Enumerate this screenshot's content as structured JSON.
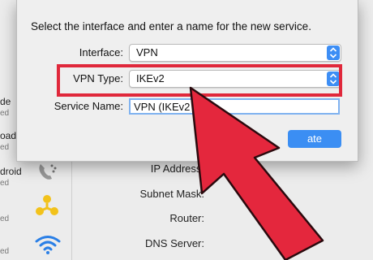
{
  "sidebar": {
    "items": [
      {
        "label": "de",
        "sub": "ed"
      },
      {
        "label": "oad",
        "sub": "ed"
      },
      {
        "label": "droid",
        "sub": "ed"
      },
      {
        "label": "",
        "sub": "ed"
      },
      {
        "label": "",
        "sub": "ed"
      }
    ]
  },
  "details": {
    "ip_label": "IP Address:",
    "subnet_label": "Subnet Mask:",
    "router_label": "Router:",
    "dns_label": "DNS Server:"
  },
  "dialog": {
    "title": "Select the interface and enter a name for the new service.",
    "interface_label": "Interface:",
    "interface_value": "VPN",
    "vpn_type_label": "VPN Type:",
    "vpn_type_value": "IKEv2",
    "service_name_label": "Service Name:",
    "service_name_value": "VPN (IKEv2",
    "create_label": "ate"
  },
  "icons": {
    "sidebar": [
      "phone-icon",
      "firewire-icon",
      "wifi-icon"
    ],
    "popup_arrows": "updown-chevron-icon"
  },
  "colors": {
    "accent_blue": "#3b8ef3",
    "highlight_red": "#e0283b",
    "arrow_red": "#e4273d"
  }
}
